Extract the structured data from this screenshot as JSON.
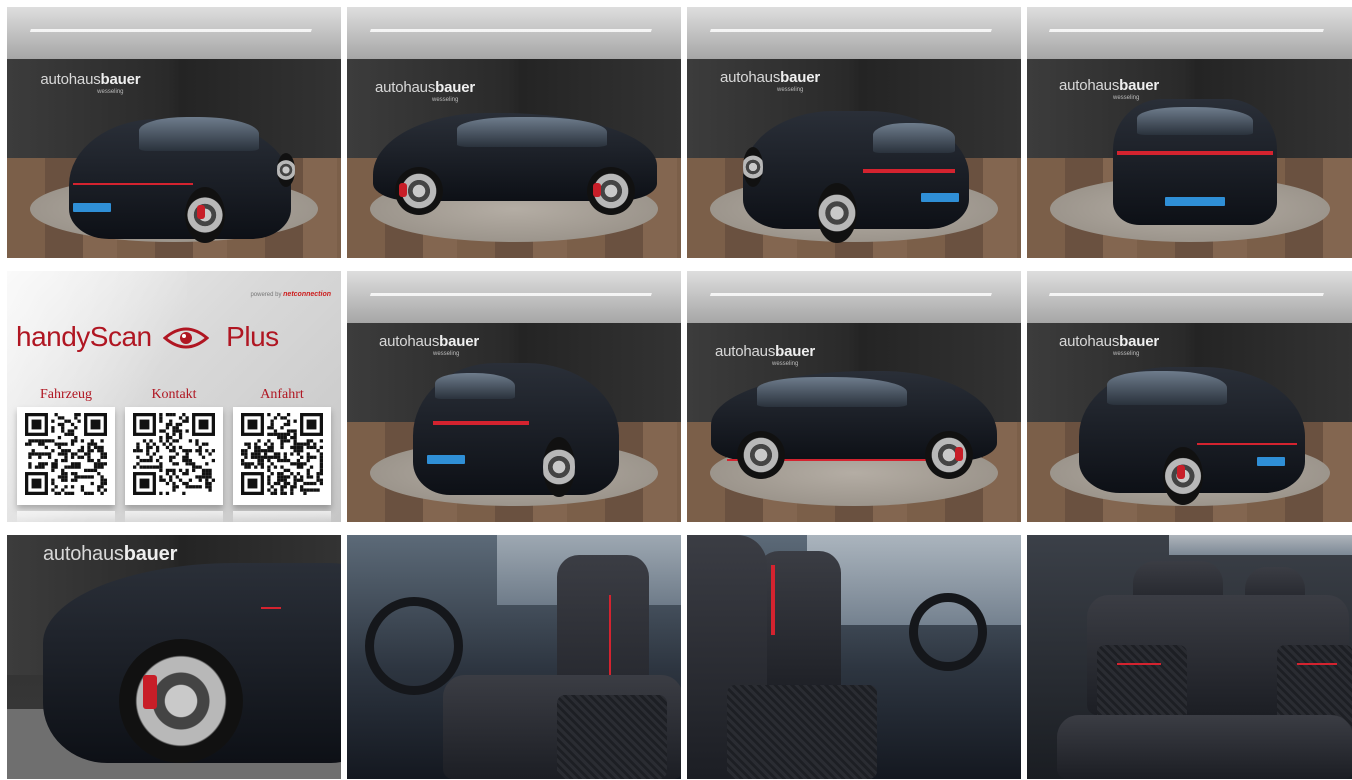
{
  "gallery": {
    "tiles": [
      {
        "id": 1,
        "kind": "showroom",
        "brand_a": "autohaus",
        "brand_b": "bauer",
        "brand_sub": "wesseling"
      },
      {
        "id": 2,
        "kind": "showroom",
        "brand_a": "autohaus",
        "brand_b": "bauer",
        "brand_sub": "wesseling"
      },
      {
        "id": 3,
        "kind": "showroom",
        "brand_a": "autohaus",
        "brand_b": "bauer",
        "brand_sub": "wesseling"
      },
      {
        "id": 4,
        "kind": "showroom",
        "brand_a": "autohaus",
        "brand_b": "bauer",
        "brand_sub": "wesseling"
      },
      {
        "id": 5,
        "kind": "handyscan"
      },
      {
        "id": 6,
        "kind": "showroom",
        "brand_a": "autohaus",
        "brand_b": "bauer",
        "brand_sub": "wesseling"
      },
      {
        "id": 7,
        "kind": "showroom",
        "brand_a": "autohaus",
        "brand_b": "bauer",
        "brand_sub": "wesseling"
      },
      {
        "id": 8,
        "kind": "showroom",
        "brand_a": "autohaus",
        "brand_b": "bauer",
        "brand_sub": "wesseling"
      },
      {
        "id": 9,
        "kind": "detail",
        "brand_a": "autohaus",
        "brand_b": "bauer"
      },
      {
        "id": 10,
        "kind": "interior"
      },
      {
        "id": 11,
        "kind": "interior"
      },
      {
        "id": 12,
        "kind": "interior"
      }
    ]
  },
  "handyscan": {
    "powered_by": "powered by",
    "partner": "netconnection",
    "title_left": "handyScan",
    "title_right": "Plus",
    "icon": "eye-icon",
    "qr_codes": [
      {
        "label": "Fahrzeug"
      },
      {
        "label": "Kontakt"
      },
      {
        "label": "Anfahrt"
      }
    ]
  },
  "colors": {
    "car_paint": "#141820",
    "accent_red": "#d4232f",
    "plate_blue": "#2f8fd6",
    "handyscan_red": "#b01622"
  }
}
